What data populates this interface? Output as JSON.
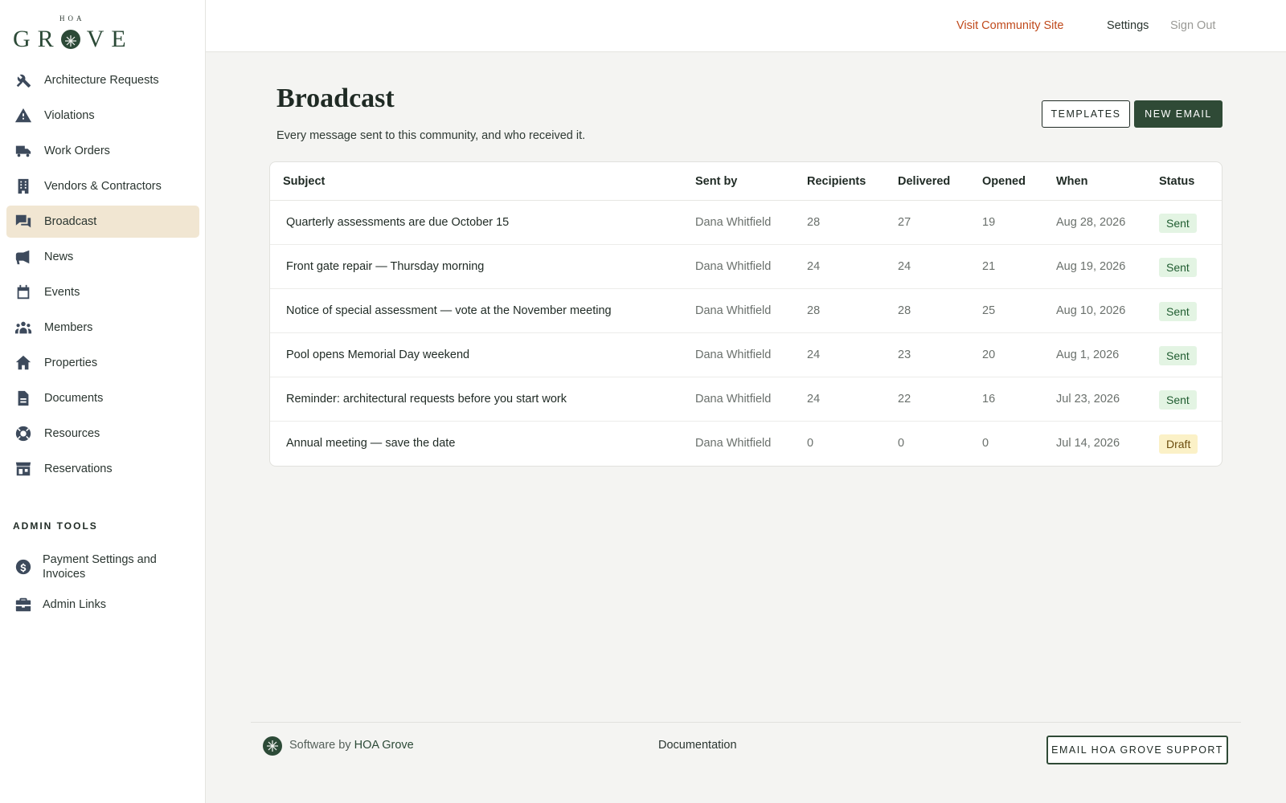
{
  "brand": {
    "logo_small": "HOA",
    "logo_main_left": "GR",
    "logo_main_right": "VE"
  },
  "sidebar": {
    "items": [
      {
        "label": "Architecture Requests",
        "icon": "tools-icon"
      },
      {
        "label": "Violations",
        "icon": "warning-icon"
      },
      {
        "label": "Work Orders",
        "icon": "truck-icon"
      },
      {
        "label": "Vendors & Contractors",
        "icon": "building-icon"
      },
      {
        "label": "Broadcast",
        "icon": "chat-icon",
        "active": true
      },
      {
        "label": "News",
        "icon": "megaphone-icon"
      },
      {
        "label": "Events",
        "icon": "calendar-icon"
      },
      {
        "label": "Members",
        "icon": "people-icon"
      },
      {
        "label": "Properties",
        "icon": "house-icon"
      },
      {
        "label": "Documents",
        "icon": "document-icon"
      },
      {
        "label": "Resources",
        "icon": "lifebuoy-icon"
      },
      {
        "label": "Reservations",
        "icon": "storefront-icon"
      }
    ],
    "admin_title": "ADMIN TOOLS",
    "admin_items": [
      {
        "label": "Payment Settings and Invoices",
        "icon": "dollar-icon"
      },
      {
        "label": "Admin Links",
        "icon": "briefcase-icon"
      }
    ]
  },
  "topbar": {
    "visit": "Visit Community Site",
    "settings": "Settings",
    "signout": "Sign Out"
  },
  "main": {
    "title": "Broadcast",
    "subtitle": "Every message sent to this community, and who received it.",
    "templates_btn": "TEMPLATES",
    "new_btn": "NEW EMAIL",
    "columns": [
      "Subject",
      "Sent by",
      "Recipients",
      "Delivered",
      "Opened",
      "When",
      "Status"
    ],
    "rows": [
      {
        "subject": "Quarterly assessments are due October 15",
        "sender": "Dana Whitfield",
        "recipients": "28",
        "delivered": "27",
        "opened": "19",
        "when": "Aug 28, 2026",
        "status": "Sent"
      },
      {
        "subject": "Front gate repair — Thursday morning",
        "sender": "Dana Whitfield",
        "recipients": "24",
        "delivered": "24",
        "opened": "21",
        "when": "Aug 19, 2026",
        "status": "Sent"
      },
      {
        "subject": "Notice of special assessment — vote at the November meeting",
        "sender": "Dana Whitfield",
        "recipients": "28",
        "delivered": "28",
        "opened": "25",
        "when": "Aug 10, 2026",
        "status": "Sent"
      },
      {
        "subject": "Pool opens Memorial Day weekend",
        "sender": "Dana Whitfield",
        "recipients": "24",
        "delivered": "23",
        "opened": "20",
        "when": "Aug 1, 2026",
        "status": "Sent"
      },
      {
        "subject": "Reminder: architectural requests before you start work",
        "sender": "Dana Whitfield",
        "recipients": "24",
        "delivered": "22",
        "opened": "16",
        "when": "Jul 23, 2026",
        "status": "Sent"
      },
      {
        "subject": "Annual meeting — save the date",
        "sender": "Dana Whitfield",
        "recipients": "0",
        "delivered": "0",
        "opened": "0",
        "when": "Jul 14, 2026",
        "status": "Draft"
      }
    ]
  },
  "footer": {
    "by_prefix": "Software by",
    "by_brand": "HOA Grove",
    "documentation": "Documentation",
    "support_btn": "EMAIL HOA GROVE SUPPORT"
  },
  "colors": {
    "accent": "#2f4a36",
    "active_nav": "#f1e6d2",
    "visit_link": "#c04a1c",
    "sent_badge": "#e3f4e3",
    "draft_badge": "#fbf1c7"
  }
}
